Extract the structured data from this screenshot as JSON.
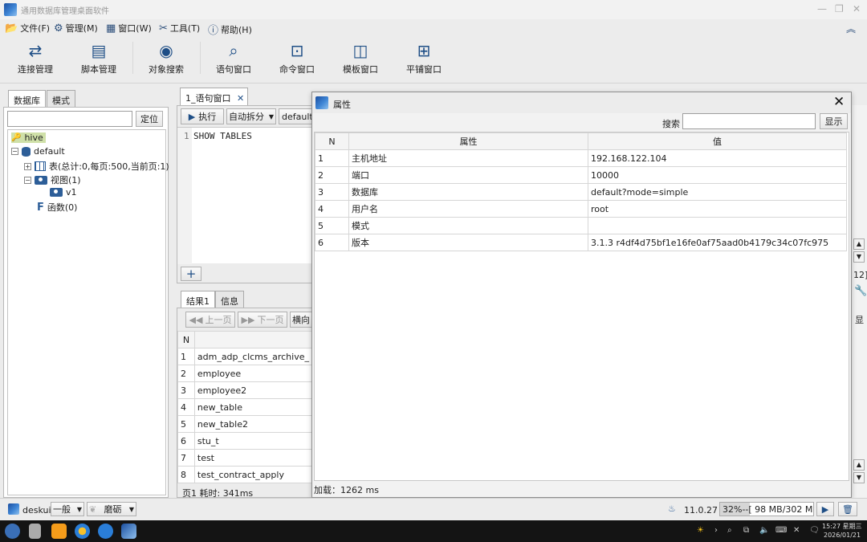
{
  "app": {
    "title": "通用数据库管理桌面软件"
  },
  "menu": [
    {
      "icon": "folder-icon",
      "label": "文件(F)"
    },
    {
      "icon": "gear-icon",
      "label": "管理(M)"
    },
    {
      "icon": "window-icon",
      "label": "窗口(W)"
    },
    {
      "icon": "tools-icon",
      "label": "工具(T)"
    },
    {
      "icon": "help-icon",
      "label": "帮助(H)"
    }
  ],
  "toolbar": [
    {
      "icon": "refresh-icon",
      "label": "连接管理"
    },
    {
      "icon": "book-icon",
      "label": "脚本管理"
    },
    {
      "icon": "object-search-icon",
      "label": "对象搜索"
    },
    {
      "icon": "search-icon",
      "label": "语句窗口"
    },
    {
      "icon": "command-icon",
      "label": "命令窗口"
    },
    {
      "icon": "template-icon",
      "label": "模板窗口"
    },
    {
      "icon": "tile-icon",
      "label": "平铺窗口"
    }
  ],
  "left_panel": {
    "tabs": [
      "数据库",
      "模式"
    ],
    "locate_button": "定位",
    "tree": {
      "root": "hive",
      "db": "default",
      "tables": "表(总计:0,每页:500,当前页:1)",
      "views": "视图(1)",
      "view_item": "v1",
      "functions": "函数(0)"
    }
  },
  "editor": {
    "tab_label": "1_语句窗口",
    "execute_label": "执行",
    "split_label": "自动拆分",
    "schema_label": "default",
    "line_number": "1",
    "sql": "SHOW TABLES",
    "add_button": "+"
  },
  "results": {
    "tabs": [
      "结果1",
      "信息"
    ],
    "prev_label": "上一页",
    "next_label": "下一页",
    "orient_label": "横向",
    "header": "N",
    "rows": [
      {
        "n": "1",
        "name": "adm_adp_clcms_archive_"
      },
      {
        "n": "2",
        "name": "employee"
      },
      {
        "n": "3",
        "name": "employee2"
      },
      {
        "n": "4",
        "name": "new_table"
      },
      {
        "n": "5",
        "name": "new_table2"
      },
      {
        "n": "6",
        "name": "stu_t"
      },
      {
        "n": "7",
        "name": "test"
      },
      {
        "n": "8",
        "name": "test_contract_apply"
      }
    ],
    "footer": "页1 耗时: 341ms"
  },
  "right_fragments": {
    "label1": "12]",
    "label2": "显"
  },
  "dialog": {
    "title": "属性",
    "search_label": "搜索",
    "show_button": "显示",
    "headers": [
      "N",
      "属性",
      "值"
    ],
    "rows": [
      {
        "n": "1",
        "attr": "主机地址",
        "value": "192.168.122.104"
      },
      {
        "n": "2",
        "attr": "端口",
        "value": "10000"
      },
      {
        "n": "3",
        "attr": "数据库",
        "value": "default?mode=simple"
      },
      {
        "n": "4",
        "attr": "用户名",
        "value": "root"
      },
      {
        "n": "5",
        "attr": "模式",
        "value": ""
      },
      {
        "n": "6",
        "attr": "版本",
        "value": "3.1.3 r4df4d75bf1e16fe0af75aad0b4179c34c07fc975"
      }
    ],
    "footer": "加载：1262 ms"
  },
  "status": {
    "user": "deskui",
    "level": "一般",
    "theme": "磨砺",
    "java_version": "11.0.27",
    "memory": "32%--[ 98 MB/302 MB ]"
  },
  "taskbar": {
    "time": "15:27 星期三",
    "date": "2026/01/21"
  }
}
